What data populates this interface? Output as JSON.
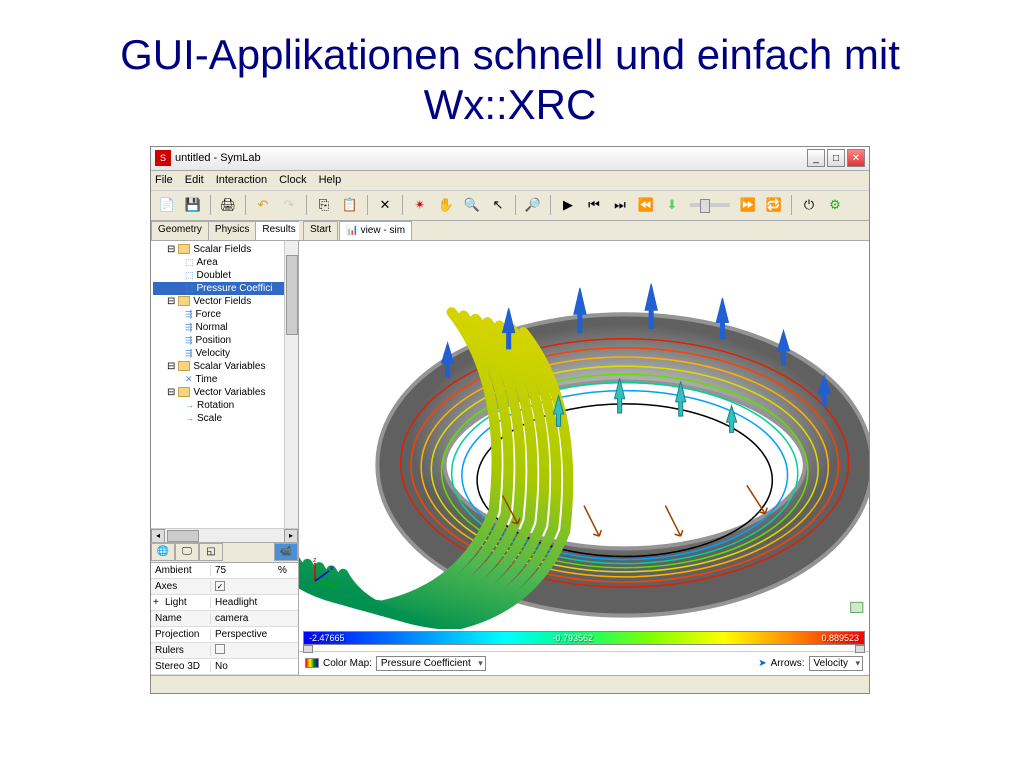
{
  "slide": {
    "title": "GUI-Applikationen schnell und einfach mit Wx::XRC"
  },
  "window": {
    "title": "untitled - SymLab"
  },
  "menu": [
    "File",
    "Edit",
    "Interaction",
    "Clock",
    "Help"
  ],
  "left_tabs": [
    "Geometry",
    "Physics",
    "Results"
  ],
  "active_left_tab": "Results",
  "tree": [
    {
      "label": "Scalar Fields",
      "type": "folder",
      "level": 1
    },
    {
      "label": "Area",
      "type": "field",
      "level": 2
    },
    {
      "label": "Doublet",
      "type": "field",
      "level": 2
    },
    {
      "label": "Pressure Coeffici",
      "type": "field",
      "level": 2,
      "selected": true
    },
    {
      "label": "Vector Fields",
      "type": "folder",
      "level": 1
    },
    {
      "label": "Force",
      "type": "vec",
      "level": 2
    },
    {
      "label": "Normal",
      "type": "vec",
      "level": 2
    },
    {
      "label": "Position",
      "type": "vec",
      "level": 2
    },
    {
      "label": "Velocity",
      "type": "vec",
      "level": 2
    },
    {
      "label": "Scalar Variables",
      "type": "folder",
      "level": 1
    },
    {
      "label": "Time",
      "type": "scalar",
      "level": 2
    },
    {
      "label": "Vector Variables",
      "type": "folder",
      "level": 1
    },
    {
      "label": "Rotation",
      "type": "vec",
      "level": 2
    },
    {
      "label": "Scale",
      "type": "vec",
      "level": 2
    }
  ],
  "props": [
    {
      "name": "Ambient",
      "value": "75",
      "unit": "%"
    },
    {
      "name": "Axes",
      "value": "checked"
    },
    {
      "name": "Light",
      "value": "Headlight",
      "expandable": true
    },
    {
      "name": "Name",
      "value": "camera"
    },
    {
      "name": "Projection",
      "value": "Perspective"
    },
    {
      "name": "Rulers",
      "value": "unchecked"
    },
    {
      "name": "Stereo 3D",
      "value": "No"
    }
  ],
  "right_tabs": [
    "Start",
    "view - sim"
  ],
  "color_scale": {
    "min": "-2.47665",
    "mid": "-0.793562",
    "max": "0.889523"
  },
  "bottom": {
    "colormap_label": "Color Map:",
    "colormap_value": "Pressure Coefficient",
    "arrows_label": "Arrows:",
    "arrows_value": "Velocity"
  }
}
